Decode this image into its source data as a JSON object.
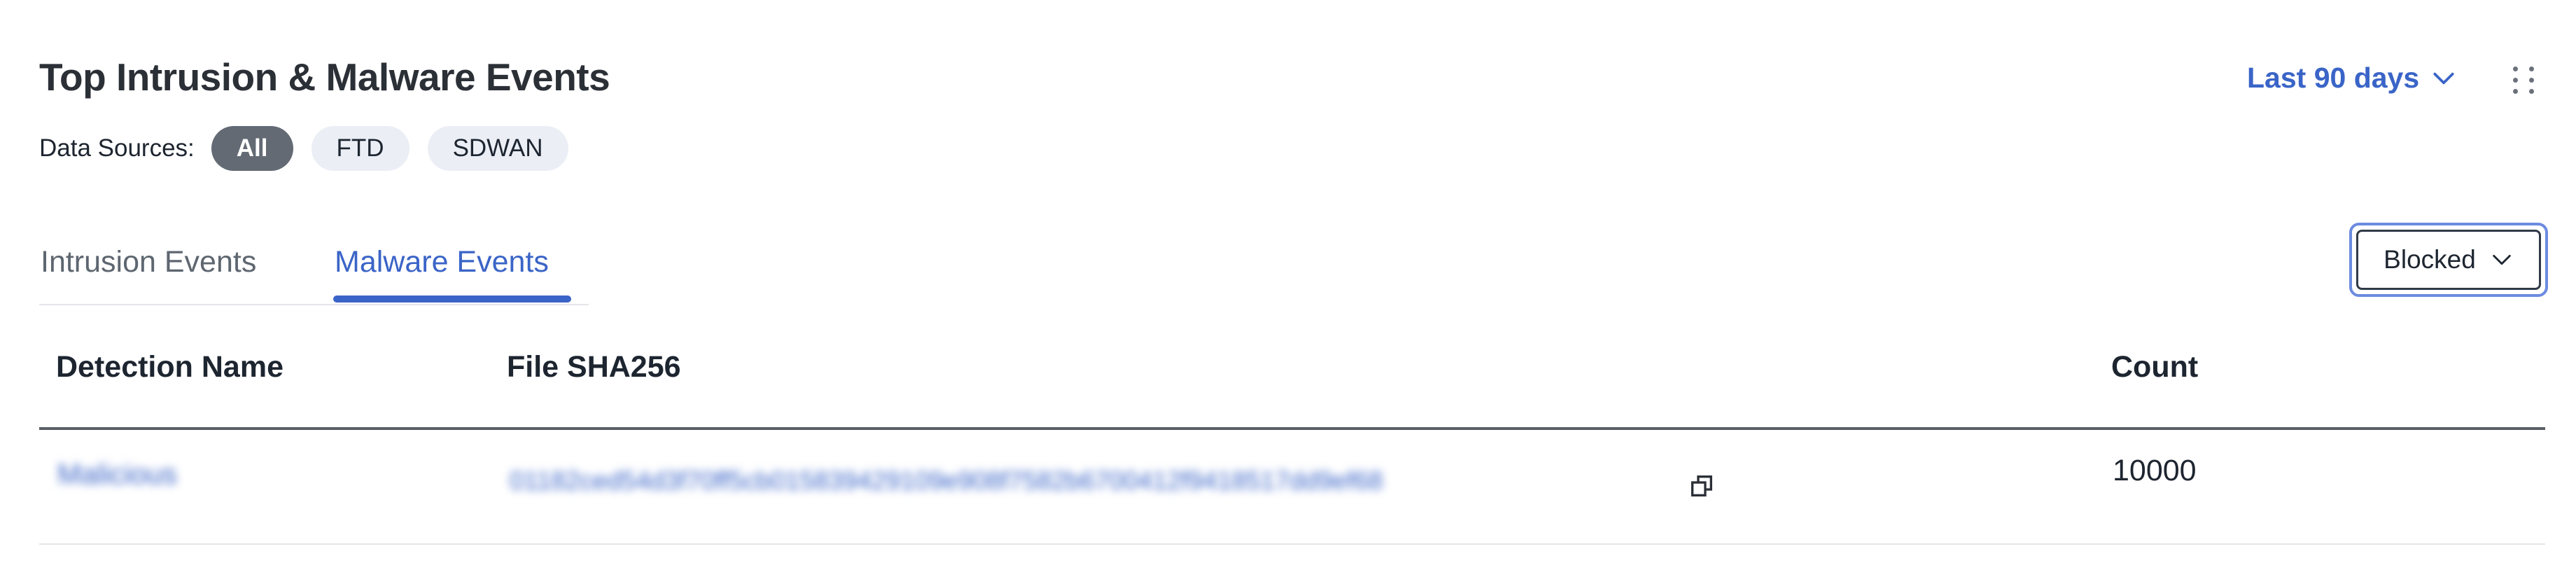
{
  "widget": {
    "title": "Top Intrusion & Malware Events",
    "time_range": "Last 90 days"
  },
  "data_sources": {
    "label": "Data Sources:",
    "options": [
      "All",
      "FTD",
      "SDWAN"
    ],
    "selected": "All"
  },
  "tabs": [
    {
      "label": "Intrusion Events",
      "active": false
    },
    {
      "label": "Malware Events",
      "active": true
    }
  ],
  "filter_select": {
    "value": "Blocked"
  },
  "table": {
    "columns": [
      "Detection Name",
      "File SHA256",
      "Count"
    ],
    "rows": [
      {
        "detection_name": "Malicious",
        "file_sha256": "01182ced54d3f70ff5cb015839429109e908f7582b6700412f9418517dd9ef68",
        "count": "10000"
      }
    ]
  },
  "colors": {
    "accent": "#3a64c7",
    "chip_active_bg": "#636a74",
    "chip_bg": "#ebeef5",
    "title": "#2b2f36"
  },
  "icons": [
    "chevron-down-icon",
    "kebab-menu-icon",
    "copy-icon"
  ]
}
